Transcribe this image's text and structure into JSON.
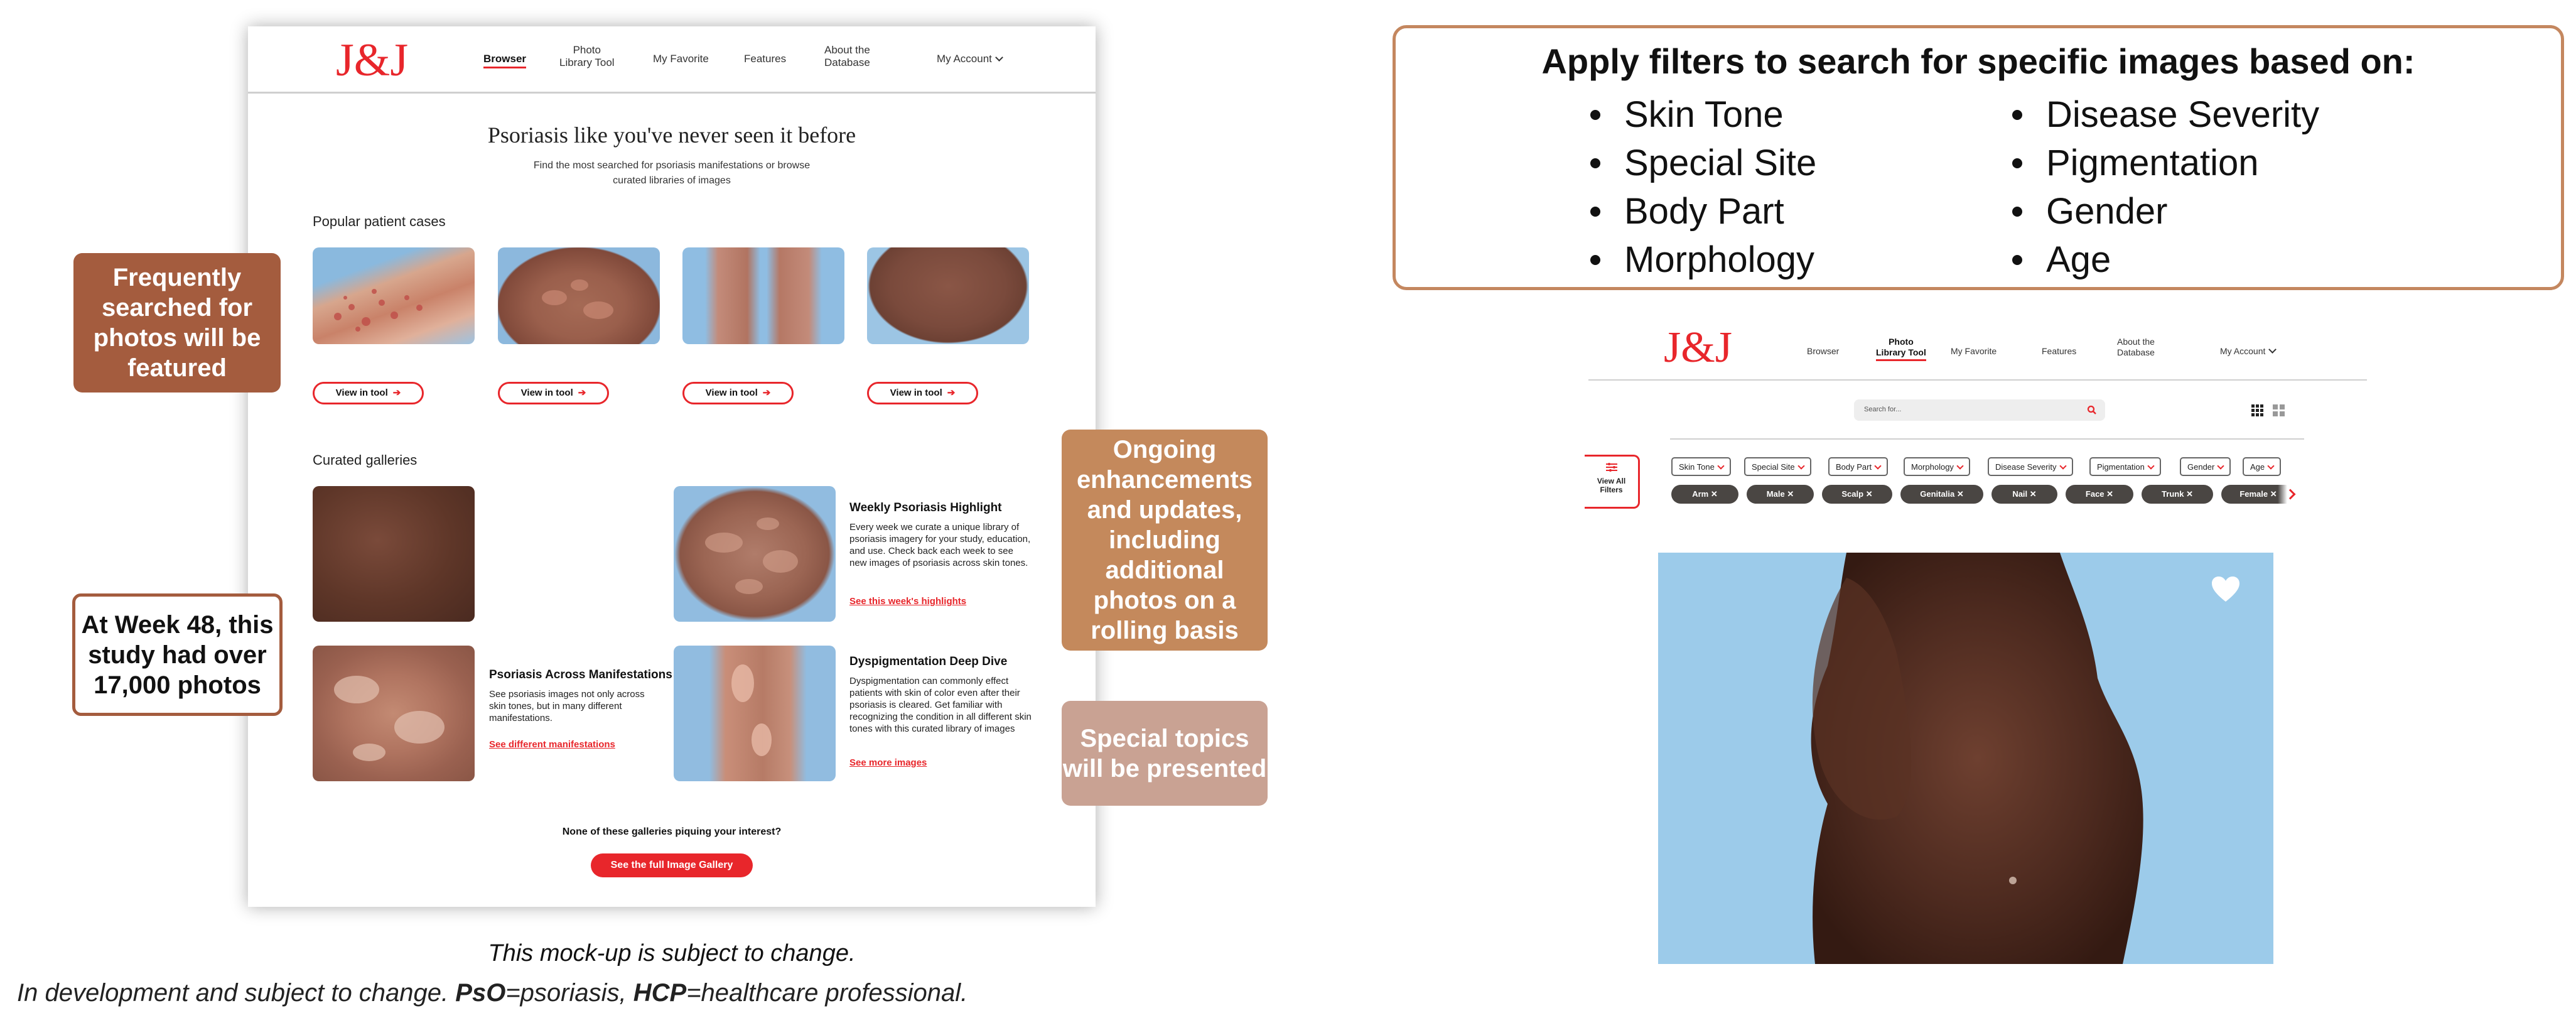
{
  "mockup_left": {
    "logo": "J&J",
    "nav": [
      "Browser",
      "Photo\nLibrary Tool",
      "My Favorite",
      "Features",
      "About the\nDatabase",
      "My Account"
    ],
    "hero_title": "Psoriasis like you've never seen it before",
    "hero_subtitle": "Find the most searched for psoriasis manifestations or browse curated libraries of images",
    "popular_heading": "Popular patient cases",
    "view_btn": "View in tool",
    "arrow": "➔",
    "curated_heading": "Curated galleries",
    "galleries": [
      {
        "title": "Weekly Psoriasis Highlight",
        "text": "Every week we curate a unique library of psoriasis imagery for your study, education, and use. Check back each week to see new images of psoriasis across skin tones.",
        "link": "See this week's highlights"
      },
      {
        "title": "Psoriasis Across Manifestations",
        "text": "See psoriasis images not only across skin tones, but in many different manifestations.",
        "link": "See different manifestations"
      },
      {
        "title": "Dyspigmentation Deep Dive",
        "text": "Dyspigmentation can commonly effect patients with skin of color even after their psoriasis is cleared. Get familiar with recognizing the condition in all different skin tones with this curated library of images",
        "link": "See more images"
      }
    ],
    "bottom_question": "None of these galleries piquing your interest?",
    "full_gallery_btn": "See the full Image Gallery"
  },
  "callouts": {
    "frequent": "Frequently searched for photos will be featured",
    "week48": "At Week 48, this study had over 17,000 photos",
    "ongoing": "Ongoing enhancements and updates, including additional photos on a rolling basis",
    "special": "Special topics will be presented"
  },
  "mockup_caption": "This mock-up is subject to change.",
  "footnote": {
    "lead": "In development and subject to change. ",
    "abbr1": "PsO",
    "def1": "=psoriasis, ",
    "abbr2": "HCP",
    "def2": "=healthcare professional."
  },
  "filters_box": {
    "title": "Apply filters to search for specific images based on:",
    "col1": [
      "Skin Tone",
      "Special Site",
      "Body Part",
      "Morphology"
    ],
    "col2": [
      "Disease Severity",
      "Pigmentation",
      "Gender",
      "Age"
    ]
  },
  "mockup_right": {
    "logo": "J&J",
    "nav": [
      "Browser",
      "Photo\nLibrary Tool",
      "My Favorite",
      "Features",
      "About the\nDatabase",
      "My Account"
    ],
    "search_placeholder": "Search for...",
    "view_all": "View All\nFilters",
    "dropdowns": [
      "Skin Tone",
      "Special Site",
      "Body Part",
      "Morphology",
      "Disease Severity",
      "Pigmentation",
      "Gender",
      "Age"
    ],
    "chips": [
      "Arm",
      "Male",
      "Scalp",
      "Genitalia",
      "Nail",
      "Face",
      "Trunk",
      "Female"
    ],
    "chip_x": "✕"
  },
  "colors": {
    "brand_red": "#e8262b",
    "callout_brown": "#a45c3e",
    "callout_tan": "#c4895c",
    "callout_pink": "#c9a293",
    "filter_border": "#c4875f"
  }
}
